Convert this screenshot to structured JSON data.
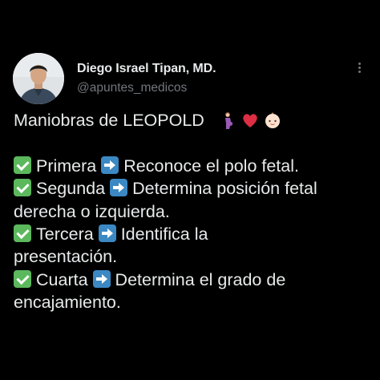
{
  "author": {
    "name": "Diego Israel Tipan, MD.",
    "handle": "@apuntes_medicos"
  },
  "tweet": {
    "title": "Maniobras de LEOPOLD",
    "title_emojis": [
      "pregnant-woman-icon",
      "red-heart-icon",
      "baby-face-icon"
    ],
    "items": [
      {
        "label": "Primera",
        "text_line1": "Reconoce el polo fetal.",
        "text_line2": ""
      },
      {
        "label": "Segunda",
        "text_line1": "Determina posición fetal",
        "text_line2": "derecha o izquierda."
      },
      {
        "label": "Tercera",
        "text_line1": "Identifica la",
        "text_line2": "presentación."
      },
      {
        "label": "Cuarta",
        "text_line1": "Determina el grado de",
        "text_line2": "encajamiento."
      }
    ]
  },
  "colors": {
    "background": "#000000",
    "text": "#e7e9ea",
    "muted": "#71767b",
    "check": "#5cb85c",
    "arrow": "#3b88c3",
    "heart": "#dd2e44"
  }
}
